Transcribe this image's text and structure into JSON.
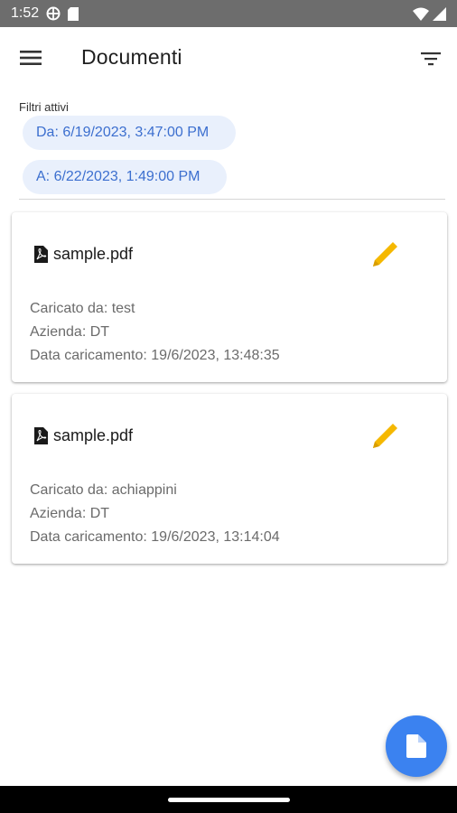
{
  "status_bar": {
    "time": "1:52",
    "icons": [
      "vpn-icon",
      "sd-card-icon",
      "wifi-icon",
      "signal-icon"
    ]
  },
  "app_bar": {
    "title": "Documenti",
    "menu_icon": "menu-icon",
    "filter_icon": "filter-icon"
  },
  "filters": {
    "label": "Filtri attivi",
    "chips": [
      {
        "label": "Da: 6/19/2023, 3:47:00 PM"
      },
      {
        "label": "A: 6/22/2023, 1:49:00 PM"
      }
    ]
  },
  "documents": [
    {
      "file_name": "sample.pdf",
      "uploaded_by": "Caricato da: test",
      "company": "Azienda: DT",
      "upload_date": "Data caricamento: 19/6/2023, 13:48:35"
    },
    {
      "file_name": "sample.pdf",
      "uploaded_by": "Caricato da: achiappini",
      "company": "Azienda: DT",
      "upload_date": "Data caricamento: 19/6/2023, 13:14:04"
    }
  ],
  "colors": {
    "accent": "#3b82f0",
    "chip_bg": "#e9f0fc",
    "chip_text": "#3c6fcf",
    "edit_icon": "#f5b800"
  },
  "fab": {
    "icon": "document-icon"
  }
}
